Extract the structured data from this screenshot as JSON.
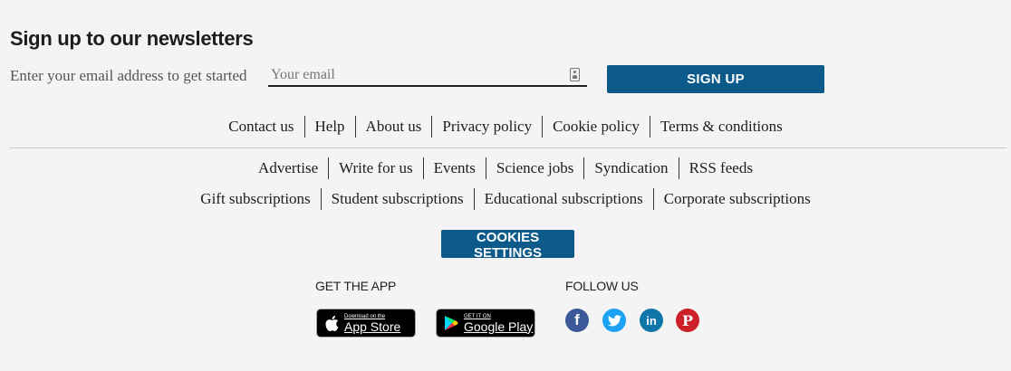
{
  "newsletter": {
    "title": "Sign up to our newsletters",
    "prompt": "Enter your email address to get started",
    "email_placeholder": "Your email",
    "email_value": "",
    "signup_label": "SIGN UP"
  },
  "footer_links_primary": [
    "Contact us",
    "Help",
    "About us",
    "Privacy policy",
    "Cookie policy",
    "Terms & conditions"
  ],
  "footer_links_secondary": [
    "Advertise",
    "Write for us",
    "Events",
    "Science jobs",
    "Syndication",
    "RSS feeds"
  ],
  "footer_links_subscriptions": [
    "Gift subscriptions",
    "Student subscriptions",
    "Educational subscriptions",
    "Corporate subscriptions"
  ],
  "cookies_label": "COOKIES SETTINGS",
  "app": {
    "label": "GET THE APP",
    "appstore_small": "Download on the",
    "appstore_big": "App Store",
    "googleplay_small": "GET IT ON",
    "googleplay_big": "Google Play"
  },
  "follow": {
    "label": "FOLLOW US",
    "networks": [
      {
        "icon": "facebook-icon",
        "glyph": "f",
        "color": "#3b5998"
      },
      {
        "icon": "twitter-icon",
        "glyph": "",
        "color": "#1da1f2"
      },
      {
        "icon": "linkedin-icon",
        "glyph": "in",
        "color": "#0e76a8"
      },
      {
        "icon": "pinterest-icon",
        "glyph": "P",
        "color": "#cb2027"
      }
    ]
  },
  "colors": {
    "accent": "#0b5a8a",
    "background": "#f4f4f4"
  }
}
